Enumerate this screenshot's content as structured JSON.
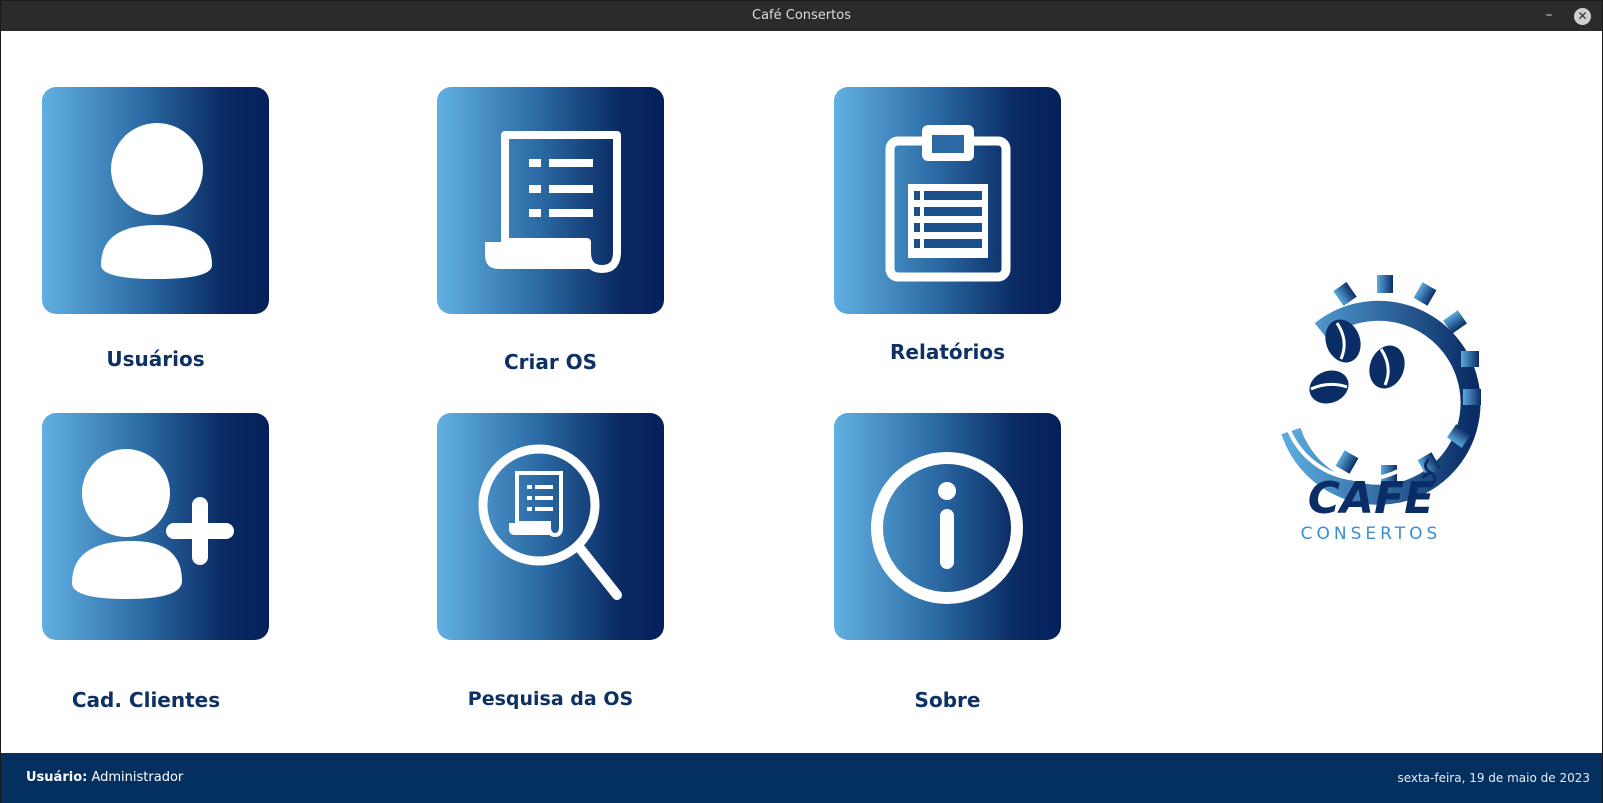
{
  "window": {
    "title": "Café Consertos",
    "minimize_glyph": "–",
    "close_glyph": "✕"
  },
  "menu": [
    {
      "label": "Usuários",
      "icon": "user-icon"
    },
    {
      "label": "Criar OS",
      "icon": "document-list-icon"
    },
    {
      "label": "Relatórios",
      "icon": "clipboard-icon"
    },
    {
      "label": "Cad. Clientes",
      "icon": "add-user-icon"
    },
    {
      "label": "Pesquisa da OS",
      "icon": "search-document-icon"
    },
    {
      "label": "Sobre",
      "icon": "info-icon"
    }
  ],
  "logo": {
    "brand": "CAFÉ",
    "subtitle": "CONSERTOS",
    "icon": "coffee-gear-logo"
  },
  "status": {
    "user_label": "Usuário:",
    "user_value": "Administrador",
    "date": "sexta-feira, 19 de maio de 2023"
  },
  "colors": {
    "accent": "#04305f",
    "tile_light": "#61b0e2",
    "tile_dark": "#04205a",
    "label": "#0e3163"
  }
}
